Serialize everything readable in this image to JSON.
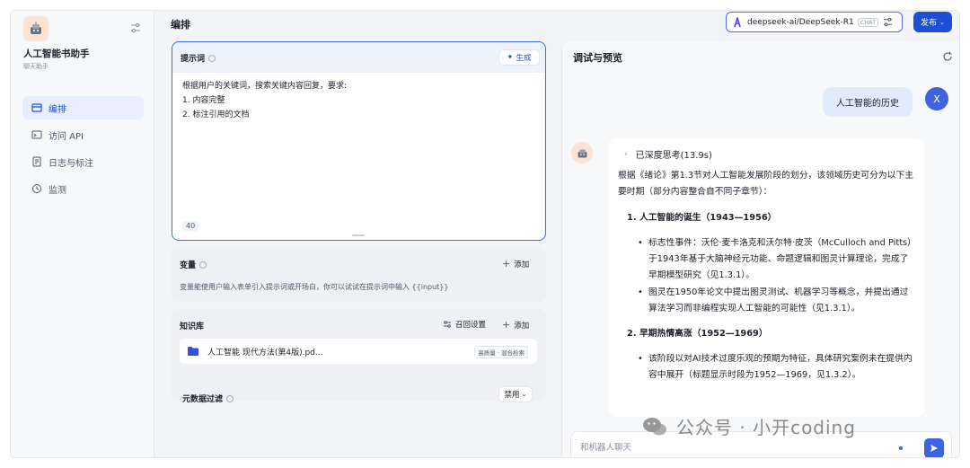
{
  "app": {
    "name": "人工智能书助手",
    "type": "聊天助手"
  },
  "sidebar": {
    "items": [
      {
        "label": "编排",
        "icon": "layout-icon",
        "active": true
      },
      {
        "label": "访问 API",
        "icon": "terminal-icon",
        "active": false
      },
      {
        "label": "日志与标注",
        "icon": "log-icon",
        "active": false
      },
      {
        "label": "监测",
        "icon": "monitor-icon",
        "active": false
      }
    ]
  },
  "header": {
    "title": "编排",
    "model": "deepseek-ai/DeepSeek-R1",
    "model_badge": "CHAT",
    "publish_label": "发布"
  },
  "prompt": {
    "label": "提示词",
    "generate_label": "生成",
    "lines": [
      "根据用户的关键词，搜索关键内容回复，要求:",
      "1. 内容完整",
      "2. 标注引用的文档"
    ],
    "char_count": "40"
  },
  "variables": {
    "label": "变量",
    "add_label": "添加",
    "description": "变量能使用户输入表单引入提示词或开场白，你可以试试在提示词中输入 {{input}}"
  },
  "knowledge": {
    "label": "知识库",
    "recall_label": "召回设置",
    "add_label": "添加",
    "item_name": "人工智能 现代方法(第4版).pd...",
    "item_tag": "高质量 · 混合检索",
    "meta_filter_label": "元数据过滤",
    "meta_filter_value": "禁用"
  },
  "debug": {
    "title": "调试与预览",
    "user_avatar": "X",
    "user_message": "人工智能的历史",
    "think_label": "已深度思考(13.9s)",
    "intro": "根据《绪论》第1.3节对人工智能发展阶段的划分，该领域历史可分为以下主要时期（部分内容整合自不同子章节）：",
    "sections": [
      {
        "heading": "1. 人工智能的诞生（1943—1956）",
        "bullets": [
          "标志性事件：沃伦·麦卡洛克和沃尔特·皮茨（McCulloch and Pitts）于1943年基于大脑神经元功能、命题逻辑和图灵计算理论，完成了早期模型研究（见1.3.1）。",
          "图灵在1950年论文中提出图灵测试、机器学习等概念，并提出通过算法学习而非编程实现人工智能的可能性（见1.3.1）。"
        ]
      },
      {
        "heading": "2. 早期热情高涨（1952—1969）",
        "bullets": [
          "该阶段以对AI技术过度乐观的预期为特征，具体研究案例未在提供内容中展开（标题显示时段为1952—1969，见1.3.2）。"
        ]
      }
    ],
    "input_placeholder": "和机器人聊天"
  },
  "watermark": "公众号 · 小开coding"
}
